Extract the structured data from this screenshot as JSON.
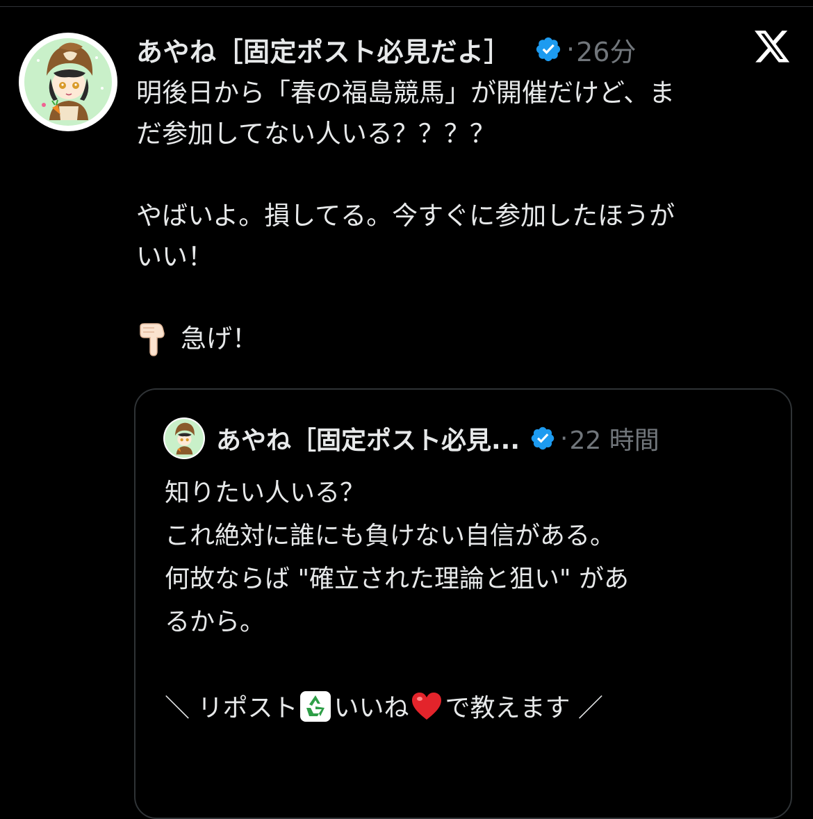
{
  "colors": {
    "background": "#000000",
    "text_primary": "#e7e9ea",
    "text_secondary": "#71767b",
    "verified_blue": "#1d9bf0",
    "border": "#2f3336"
  },
  "post": {
    "display_name": "あやね［固定ポスト必見だよ］",
    "verified_icon": "verified-badge-icon",
    "separator": "·",
    "time": "26分",
    "brand_icon": "x-logo-icon",
    "body": {
      "line1": "明後日から「春の福島競馬」が開催だけど、ま",
      "line2": "だ参加してない人いる？？？？",
      "line3": "やばいよ。損してる。今すぐに参加したほうが",
      "line4": "いい！",
      "emoji1": "backhand-index-pointing-down",
      "line5": "急げ！"
    }
  },
  "quote": {
    "display_name": "あやね［固定ポスト必見...",
    "verified_icon": "verified-badge-icon",
    "separator": "·",
    "time": "22 時間",
    "body": {
      "line1": "知りたい人いる？",
      "line2": "これ絶対に誰にも負けない自信がある。",
      "line3": "何故ならば \"確立された理論と狙い\" があ",
      "line4": "るから。",
      "line5_part1": "＼ リポスト",
      "emoji_recycle": "recycle",
      "line5_part2": "いいね",
      "emoji_heart": "red-heart",
      "line5_part3": "で教えます ／"
    }
  }
}
